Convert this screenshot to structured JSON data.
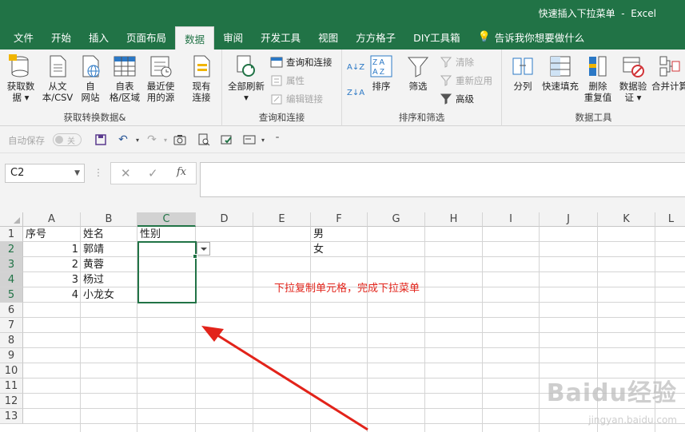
{
  "title_bar": {
    "text": "快速插入下拉菜单  -  Excel"
  },
  "tabs": [
    {
      "label": "文件",
      "active": false
    },
    {
      "label": "开始",
      "active": false
    },
    {
      "label": "插入",
      "active": false
    },
    {
      "label": "页面布局",
      "active": false
    },
    {
      "label": "数据",
      "active": true
    },
    {
      "label": "审阅",
      "active": false
    },
    {
      "label": "开发工具",
      "active": false
    },
    {
      "label": "视图",
      "active": false
    },
    {
      "label": "方方格子",
      "active": false
    },
    {
      "label": "DIY工具箱",
      "active": false
    },
    {
      "label": "告诉我你想要做什么",
      "active": false
    }
  ],
  "ribbon": {
    "get_transform": {
      "label": "获取转换数据&",
      "get_data": "获取数\n据 ▾",
      "from_csv": "从文\n本/CSV",
      "from_web": "自\n网站",
      "from_table": "自表\n格/区域",
      "recent_sources": "最近使\n用的源",
      "existing": "现有\n连接"
    },
    "queries": {
      "label": "查询和连接",
      "refresh_all": "全部刷新\n▾",
      "queries_connections": "查询和连接",
      "properties": "属性",
      "edit_links": "编辑链接"
    },
    "sort_filter": {
      "label": "排序和筛选",
      "sort": "排序",
      "filter": "筛选",
      "clear": "清除",
      "reapply": "重新应用",
      "advanced": "高级"
    },
    "data_tools": {
      "label": "数据工具",
      "text_to_columns": "分列",
      "flash_fill": "快速填充",
      "remove_duplicates": "删除\n重复值",
      "data_validation": "数据验\n证 ▾",
      "consolidate": "合并计算"
    }
  },
  "qat": {
    "autosave": "自动保存",
    "toggle": "关"
  },
  "formula_bar": {
    "name_box": "C2",
    "fx": "fx",
    "value": ""
  },
  "grid": {
    "columns": [
      "A",
      "B",
      "C",
      "D",
      "E",
      "F",
      "G",
      "H",
      "I",
      "J",
      "K",
      "L"
    ],
    "rows": [
      "1",
      "2",
      "3",
      "4",
      "5",
      "6",
      "7",
      "8",
      "9",
      "10",
      "11",
      "12",
      "13"
    ],
    "cells": {
      "A1": "序号",
      "B1": "姓名",
      "C1": "性别",
      "F1": "男",
      "A2": "1",
      "B2": "郭靖",
      "F2": "女",
      "A3": "2",
      "B3": "黄蓉",
      "A4": "3",
      "B4": "杨过",
      "A5": "4",
      "B5": "小龙女"
    },
    "selected": "C2",
    "selection_range": "C2:C5"
  },
  "annotation": {
    "text": "下拉复制单元格，完成下拉菜单",
    "color": "#e2231a"
  },
  "watermark": {
    "brand": "Baidu经验",
    "url": "jingyan.baidu.com"
  },
  "colors": {
    "excel_green": "#217346",
    "annotation_red": "#e2231a"
  }
}
